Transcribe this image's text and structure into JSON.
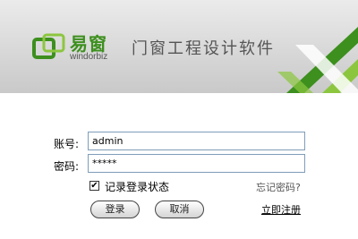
{
  "banner": {
    "brand_name": "易窗",
    "brand_domain": "windorbiz",
    "slogan": "门窗工程设计软件"
  },
  "form": {
    "account_label": "账号:",
    "account_value": "admin",
    "password_label": "密码:",
    "password_value": "*****",
    "remember_label": "记录登录状态",
    "remember_checked": true,
    "forgot_label": "忘记密码?"
  },
  "buttons": {
    "login_label": "登录",
    "cancel_label": "取消",
    "register_label": "立即注册"
  },
  "colors": {
    "brand_green": "#3d8f1e",
    "accent_lime": "#8cc63f"
  }
}
